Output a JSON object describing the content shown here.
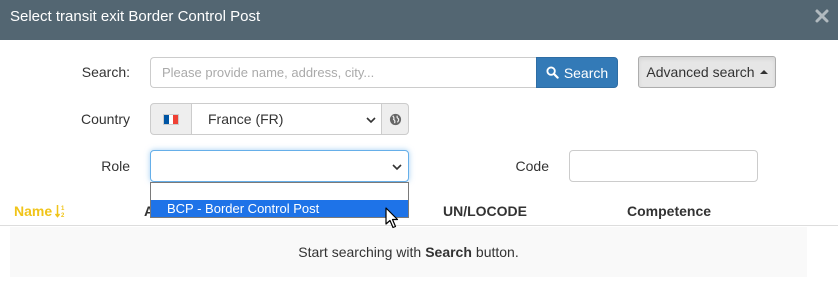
{
  "modal": {
    "title": "Select transit exit Border Control Post"
  },
  "search": {
    "label": "Search:",
    "placeholder": "Please provide name, address, city...",
    "button_label": "Search",
    "advanced_label": "Advanced search"
  },
  "country": {
    "label": "Country",
    "selected": "France (FR)",
    "flag_colors": [
      "#0055a4",
      "#ffffff",
      "#ef4135"
    ]
  },
  "role": {
    "label": "Role",
    "selected": "",
    "options": [
      "",
      "BCP - Border Control Post"
    ]
  },
  "code": {
    "label": "Code",
    "value": ""
  },
  "table": {
    "columns": [
      "Name",
      "A",
      "UN/LOCODE",
      "Competence"
    ],
    "empty_prefix": "Start searching with",
    "empty_keyword": "Search",
    "empty_suffix": "button."
  },
  "colors": {
    "header_bg": "#536672",
    "primary": "#337ab7",
    "sort_active": "#f0c419",
    "highlight": "#1e73e8"
  }
}
